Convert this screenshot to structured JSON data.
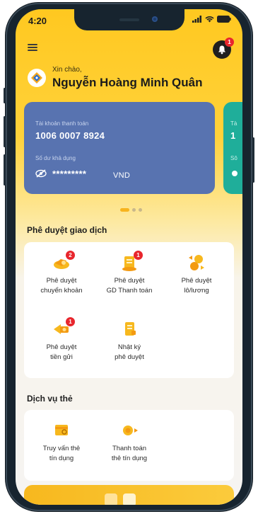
{
  "status": {
    "time": "4:20"
  },
  "header": {
    "greeting": "Xin chào,",
    "user_name": "Nguyễn Hoàng Minh Quân",
    "notification_count": "1"
  },
  "accounts": [
    {
      "type_label": "Tài khoản thanh toán",
      "number": "1006 0007 8924",
      "balance_label": "Số dư khả dụng",
      "balance_masked": "*********",
      "currency": "VND",
      "color": "#5873b0"
    },
    {
      "type_label": "Tà",
      "number": "1",
      "balance_label": "Sô",
      "color": "#1fae9a"
    }
  ],
  "carousel": {
    "page_count": 3,
    "active_index": 0
  },
  "approvals": {
    "title": "Phê duyệt giao dịch",
    "items": [
      {
        "line1": "Phê duyệt",
        "line2": "chuyển khoản",
        "badge": "2",
        "icon": "transfer-approval-icon"
      },
      {
        "line1": "Phê duyệt",
        "line2": "GD Thanh toán",
        "badge": "1",
        "icon": "payment-approval-icon"
      },
      {
        "line1": "Phê duyệt",
        "line2": "lô/lương",
        "badge": "",
        "icon": "payroll-approval-icon"
      },
      {
        "line1": "Phê duyệt",
        "line2": "tiền gửi",
        "badge": "1",
        "icon": "deposit-approval-icon"
      },
      {
        "line1": "Nhật ký",
        "line2": "phê duyệt",
        "badge": "",
        "icon": "approval-log-icon"
      }
    ]
  },
  "card_services": {
    "title": "Dịch vụ thẻ",
    "items": [
      {
        "line1": "Truy vấn thẻ",
        "line2": "tín dụng",
        "icon": "credit-card-inquiry-icon"
      },
      {
        "line1": "Thanh toán",
        "line2": "thẻ tín dụng",
        "icon": "credit-card-payment-icon"
      }
    ]
  },
  "colors": {
    "accent_yellow": "#ffc820",
    "badge_red": "#e8262d",
    "card_blue": "#5873b0",
    "card_teal": "#1fae9a"
  }
}
